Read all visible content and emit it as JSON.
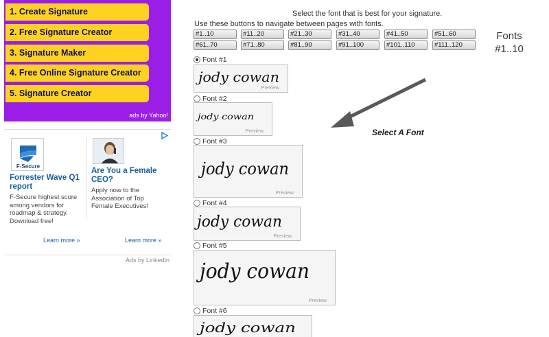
{
  "yahoo_ads": {
    "links": [
      "1. Create Signature",
      "2. Free Signature Creator",
      "3. Signature Maker",
      "4. Free Online Signature Creator",
      "5. Signature Creator"
    ],
    "credit": "ads by Yahoo!"
  },
  "linkedin_ads": {
    "adchoices_icon": "adchoices-icon",
    "ads": [
      {
        "logo": "F-Secure",
        "title": "Forrester Wave Q1 report",
        "body": "F-Secure highest score among vendors for roadmap & strategy. Download free!",
        "more": "Learn more »"
      },
      {
        "logo": "",
        "title": "Are You a Female CEO?",
        "body": "Apply now to the Association of Top Female Executives!",
        "more": "Learn more »"
      }
    ],
    "credit": "Ads by LinkedIn"
  },
  "main": {
    "instruction": "Select the font that is best for your signature.",
    "nav_text": "Use these buttons to navigate between pages with fonts.",
    "page_buttons": [
      "#1..10",
      "#11..20",
      "#21..30",
      "#31..40",
      "#41..50",
      "#51..60",
      "#61..70",
      "#71..80",
      "#81..90",
      "#91..100",
      "#101..110",
      "#111..120"
    ],
    "range_title": "Fonts",
    "range_value": "#1..10",
    "annotation": "Select A Font",
    "preview_tag": "Preview",
    "signature_text": "jody cowan",
    "signature_text_spaced": "jody   cowan",
    "fonts": [
      {
        "label": "Font #1",
        "checked": true
      },
      {
        "label": "Font #2",
        "checked": false
      },
      {
        "label": "Font #3",
        "checked": false
      },
      {
        "label": "Font #4",
        "checked": false
      },
      {
        "label": "Font #5",
        "checked": false
      },
      {
        "label": "Font #6",
        "checked": false
      }
    ]
  },
  "colors": {
    "panel_purple": "#9b1ee6",
    "button_yellow": "#ffd21f",
    "link_blue": "#1a5ea0"
  }
}
